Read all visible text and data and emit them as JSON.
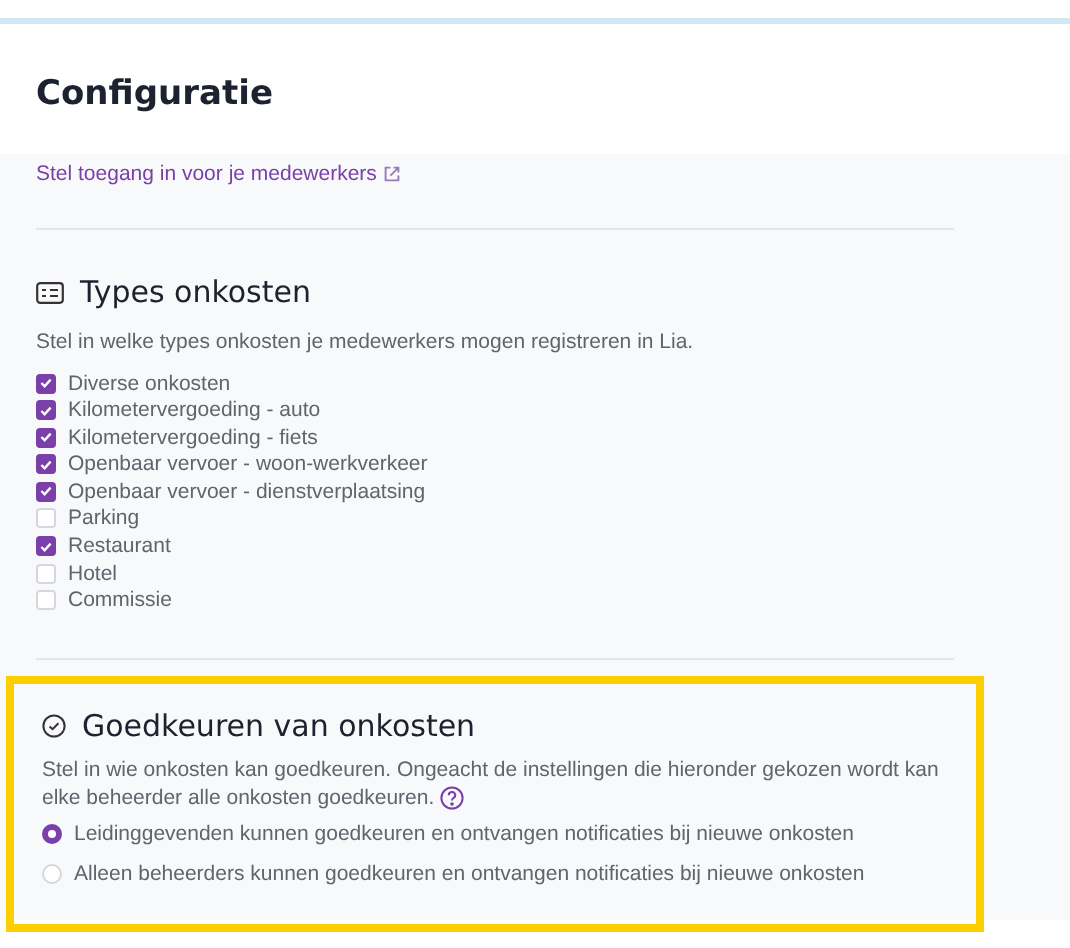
{
  "header": {
    "title": "Configuratie"
  },
  "access_link": {
    "label": "Stel toegang in voor je medewerkers"
  },
  "expense_types": {
    "title": "Types onkosten",
    "description": "Stel in welke types onkosten je medewerkers mogen registreren in Lia.",
    "items": [
      {
        "label": "Diverse onkosten",
        "checked": true
      },
      {
        "label": "Kilometervergoeding - auto",
        "checked": true
      },
      {
        "label": "Kilometervergoeding - fiets",
        "checked": true
      },
      {
        "label": "Openbaar vervoer - woon-werkverkeer",
        "checked": true
      },
      {
        "label": "Openbaar vervoer - dienstverplaatsing",
        "checked": true
      },
      {
        "label": "Parking",
        "checked": false
      },
      {
        "label": "Restaurant",
        "checked": true
      },
      {
        "label": "Hotel",
        "checked": false
      },
      {
        "label": "Commissie",
        "checked": false
      }
    ]
  },
  "approval": {
    "title": "Goedkeuren van onkosten",
    "description": "Stel in wie onkosten kan goedkeuren. Ongeacht de instellingen die hieronder gekozen wordt kan elke beheerder alle onkosten goedkeuren.",
    "options": [
      {
        "label": "Leidinggevenden kunnen goedkeuren en ontvangen notificaties bij nieuwe onkosten",
        "selected": true
      },
      {
        "label": "Alleen beheerders kunnen goedkeuren en ontvangen notificaties bij nieuwe onkosten",
        "selected": false
      }
    ]
  }
}
